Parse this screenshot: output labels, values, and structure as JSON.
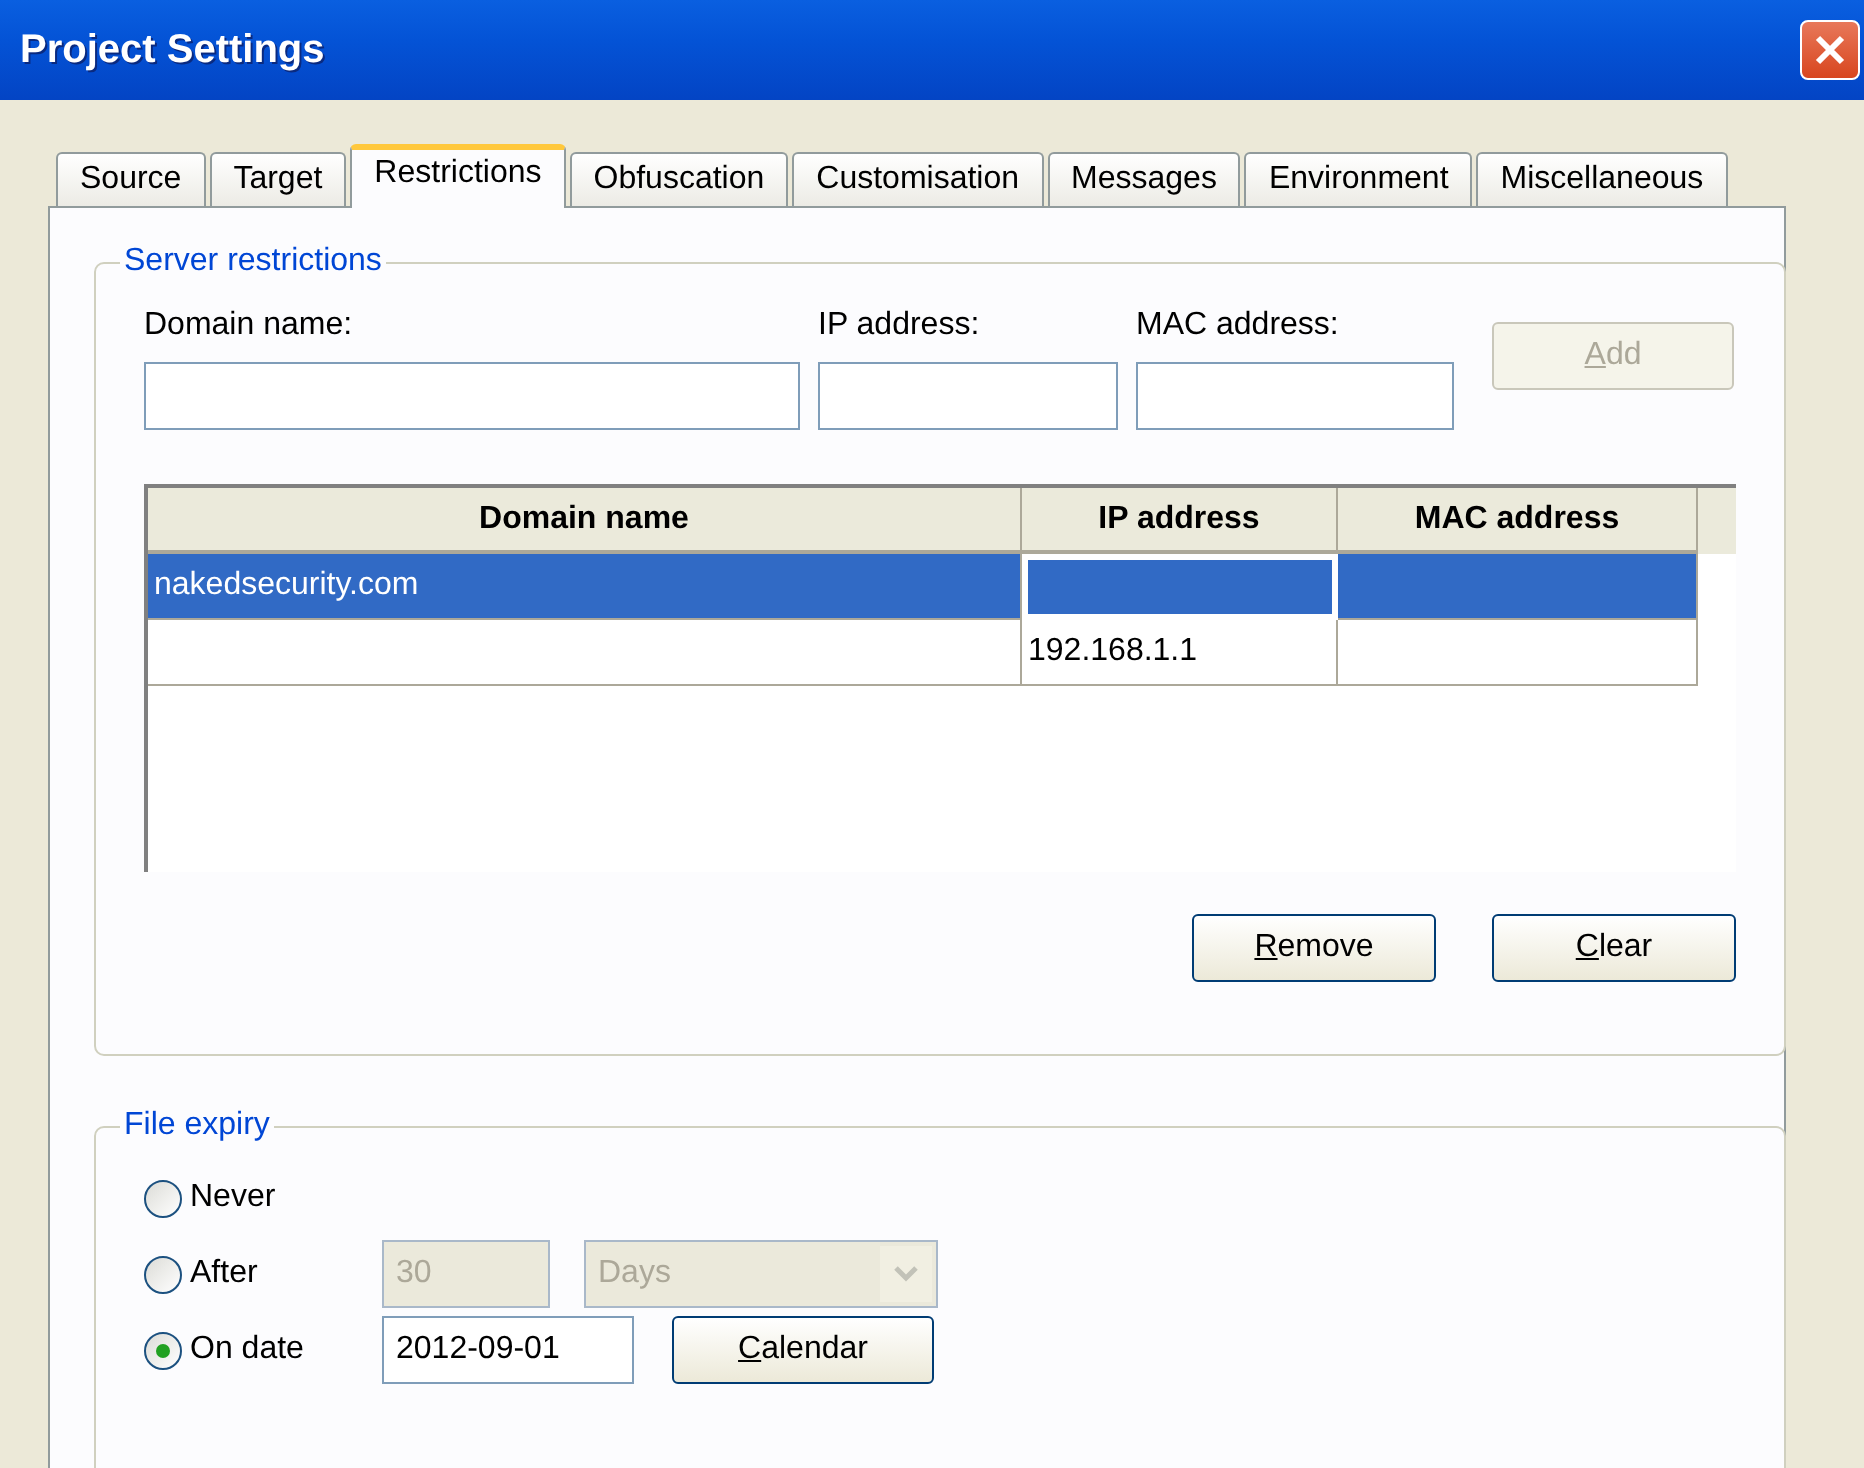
{
  "window": {
    "title": "Project Settings"
  },
  "tabs": [
    {
      "label": "Source",
      "selected": false
    },
    {
      "label": "Target",
      "selected": false
    },
    {
      "label": "Restrictions",
      "selected": true
    },
    {
      "label": "Obfuscation",
      "selected": false
    },
    {
      "label": "Customisation",
      "selected": false
    },
    {
      "label": "Messages",
      "selected": false
    },
    {
      "label": "Environment",
      "selected": false
    },
    {
      "label": "Miscellaneous",
      "selected": false
    }
  ],
  "server_restrictions": {
    "title": "Server restrictions",
    "fields": [
      {
        "label": "Domain name:"
      },
      {
        "label": "IP address:"
      },
      {
        "label": "MAC address:"
      }
    ],
    "add_button": {
      "label": "Add",
      "disabled": true
    },
    "table": {
      "columns": [
        "Domain name",
        "IP address",
        "MAC address"
      ],
      "rows": [
        {
          "selected": true,
          "cells": [
            {
              "text": "nakedsecurity.com",
              "focused": false
            },
            {
              "focused": true
            },
            {
              "focused": false
            }
          ]
        },
        {
          "selected": false,
          "cells": [
            {
              "focused": false
            },
            {
              "text": "192.168.1.1",
              "focused": false
            },
            {
              "focused": false
            }
          ]
        }
      ]
    },
    "buttons": [
      {
        "label": "Remove"
      },
      {
        "label": "Clear"
      }
    ]
  },
  "file_expiry": {
    "title": "File expiry",
    "options": [
      {
        "kind": "plain",
        "label": "Never",
        "selected": false
      },
      {
        "kind": "period",
        "label": "After",
        "selected": false,
        "disabled": true,
        "value": "30",
        "unit": "Days"
      },
      {
        "kind": "date",
        "label": "On date",
        "selected": true,
        "value": "2012-09-01",
        "button": "Calendar"
      }
    ]
  }
}
